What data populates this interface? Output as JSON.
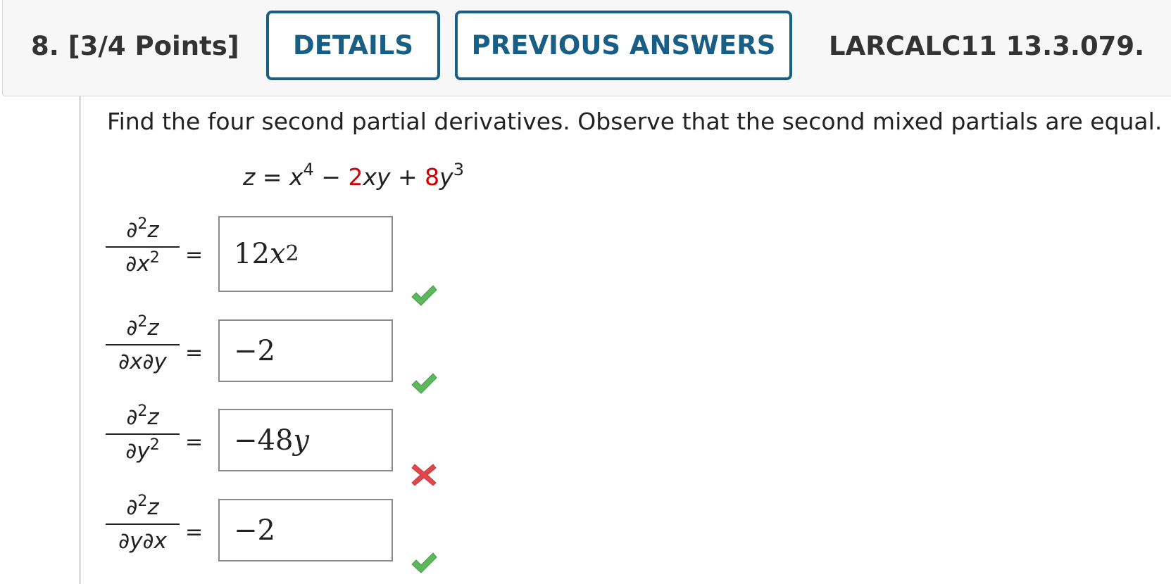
{
  "header": {
    "question_number": "8.",
    "points": "[3/4 Points]",
    "details_label": "DETAILS",
    "previous_answers_label": "PREVIOUS ANSWERS",
    "problem_code": "LARCALC11 13.3.079."
  },
  "question": {
    "prompt": "Find the four second partial derivatives. Observe that the second mixed partials are equal.",
    "equation": {
      "lhs": "z =",
      "x_base": "x",
      "x_exp": "4",
      "minus": "−",
      "coef1": "2",
      "term1": "xy",
      "plus": "+",
      "coef2": "8",
      "y_base": "y",
      "y_exp": "3"
    }
  },
  "answers": [
    {
      "num_d": "∂",
      "num_exp": "2",
      "num_var": "z",
      "den_a": "∂x",
      "den_exp": "2",
      "den_b": "",
      "equals": "=",
      "value_coef": "12",
      "value_var": "x",
      "value_exp": "2",
      "status": "correct"
    },
    {
      "num_d": "∂",
      "num_exp": "2",
      "num_var": "z",
      "den_a": "∂x∂y",
      "den_exp": "",
      "den_b": "",
      "equals": "=",
      "value_coef": "−2",
      "value_var": "",
      "value_exp": "",
      "status": "correct"
    },
    {
      "num_d": "∂",
      "num_exp": "2",
      "num_var": "z",
      "den_a": "∂y",
      "den_exp": "2",
      "den_b": "",
      "equals": "=",
      "value_coef": "−48",
      "value_var": "y",
      "value_exp": "",
      "status": "incorrect"
    },
    {
      "num_d": "∂",
      "num_exp": "2",
      "num_var": "z",
      "den_a": "∂y∂x",
      "den_exp": "",
      "den_b": "",
      "equals": "=",
      "value_coef": "−2",
      "value_var": "",
      "value_exp": "",
      "status": "correct"
    }
  ],
  "colors": {
    "button_border": "#195e85",
    "highlight_red": "#cc0000",
    "check_green": "#5cb85c",
    "cross_red": "#e0474c"
  },
  "icons": {
    "correct": "checkmark-icon",
    "incorrect": "x-mark-icon"
  }
}
